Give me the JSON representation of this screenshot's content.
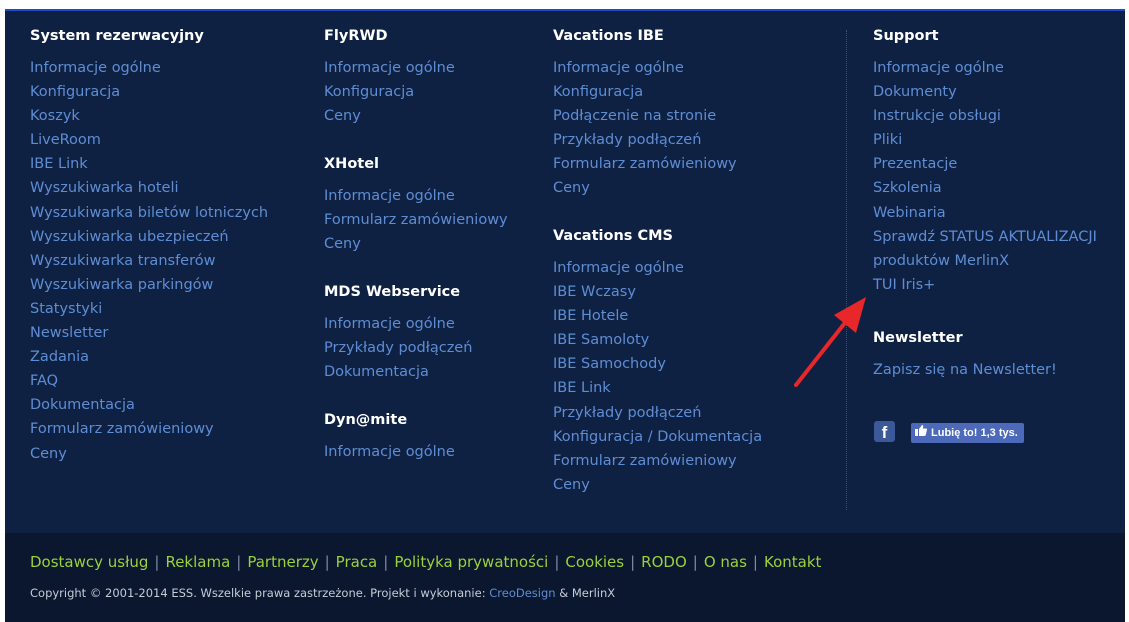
{
  "columns": [
    {
      "sections": [
        {
          "title": "System rezerwacyjny",
          "links": [
            "Informacje ogólne",
            "Konfiguracja",
            "Koszyk",
            "LiveRoom",
            "IBE Link",
            "Wyszukiwarka hoteli",
            "Wyszukiwarka biletów lotniczych",
            "Wyszukiwarka ubezpieczeń",
            "Wyszukiwarka transferów",
            "Wyszukiwarka parkingów",
            "Statystyki",
            "Newsletter",
            "Zadania",
            "FAQ",
            "Dokumentacja",
            "Formularz zamówieniowy",
            "Ceny"
          ]
        }
      ]
    },
    {
      "sections": [
        {
          "title": "FlyRWD",
          "links": [
            "Informacje ogólne",
            "Konfiguracja",
            "Ceny"
          ]
        },
        {
          "title": "XHotel",
          "links": [
            "Informacje ogólne",
            "Formularz zamówieniowy",
            "Ceny"
          ]
        },
        {
          "title": "MDS Webservice",
          "links": [
            "Informacje ogólne",
            "Przykłady podłączeń",
            "Dokumentacja"
          ]
        },
        {
          "title": "Dyn@mite",
          "links": [
            "Informacje ogólne"
          ]
        }
      ]
    },
    {
      "sections": [
        {
          "title": "Vacations IBE",
          "links": [
            "Informacje ogólne",
            "Konfiguracja",
            "Podłączenie na stronie",
            "Przykłady podłączeń",
            "Formularz zamówieniowy",
            "Ceny"
          ]
        },
        {
          "title": "Vacations CMS",
          "links": [
            "Informacje ogólne",
            "IBE Wczasy",
            "IBE Hotele",
            "IBE Samoloty",
            "IBE Samochody",
            "IBE Link",
            "Przykłady podłączeń",
            "Konfiguracja / Dokumentacja",
            "Formularz zamówieniowy",
            "Ceny"
          ]
        }
      ]
    },
    {
      "sections": [
        {
          "title": "Support",
          "links": [
            "Informacje ogólne",
            "Dokumenty",
            "Instrukcje obsługi",
            "Pliki",
            "Prezentacje",
            "Szkolenia",
            "Webinaria",
            "Sprawdź STATUS AKTUALIZACJI",
            "produktów MerlinX",
            "TUI Iris+"
          ]
        },
        {
          "title": "Newsletter",
          "links": [
            "Zapisz się na Newsletter!"
          ]
        }
      ]
    }
  ],
  "social": {
    "fb_letter": "f",
    "like_label": "Lubię to! 1,3 tys."
  },
  "footer": {
    "links": [
      "Dostawcy usług",
      "Reklama",
      "Partnerzy",
      "Praca",
      "Polityka prywatności",
      "Cookies",
      "RODO",
      "O nas",
      "Kontakt"
    ],
    "copyright_prefix": "Copyright © 2001-2014 ESS. Wszelkie prawa zastrzeżone. Projekt i wykonanie: ",
    "creo": "CreoDesign",
    "amp": " & ",
    "merlinx": "MerlinX"
  },
  "colors": {
    "background": "#0f2143",
    "link": "#5e8dd4",
    "footer_link": "#9bd13a",
    "arrow": "#e8272a"
  }
}
